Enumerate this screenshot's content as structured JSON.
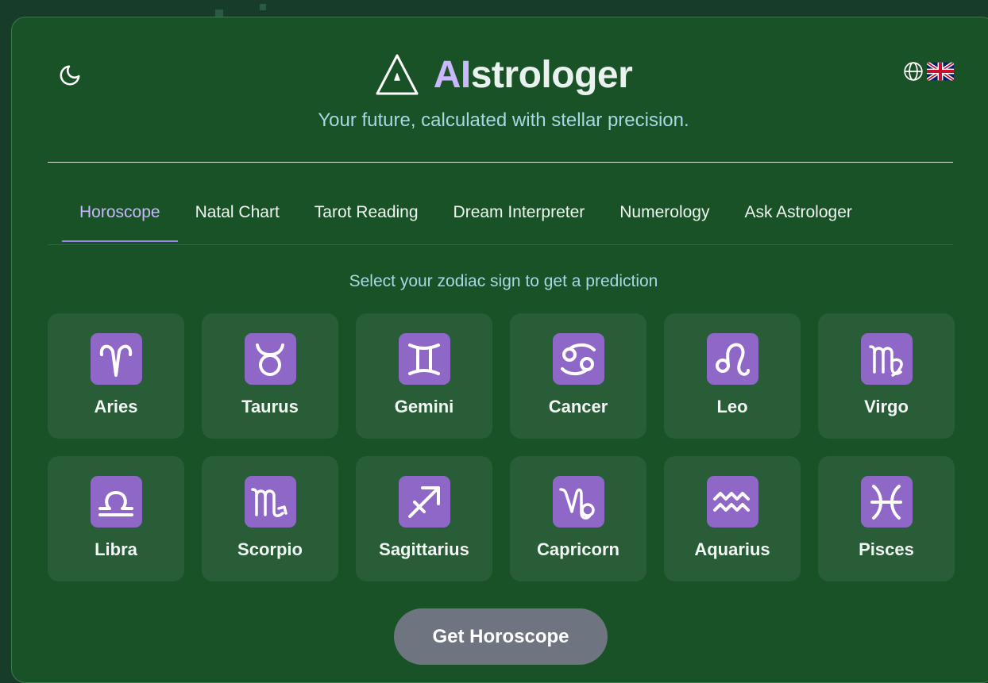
{
  "header": {
    "brand_ai": "AI",
    "brand_rest": "strologer",
    "tagline": "Your future, calculated with stellar precision.",
    "theme_icon": "moon-icon",
    "language_icon": "globe-icon",
    "language_flag": "uk-flag"
  },
  "tabs": [
    {
      "label": "Horoscope",
      "active": true
    },
    {
      "label": "Natal Chart",
      "active": false
    },
    {
      "label": "Tarot Reading",
      "active": false
    },
    {
      "label": "Dream Interpreter",
      "active": false
    },
    {
      "label": "Numerology",
      "active": false
    },
    {
      "label": "Ask Astrologer",
      "active": false
    }
  ],
  "prompt": "Select your zodiac sign to get a prediction",
  "signs": [
    {
      "name": "Aries",
      "icon": "aries-icon"
    },
    {
      "name": "Taurus",
      "icon": "taurus-icon"
    },
    {
      "name": "Gemini",
      "icon": "gemini-icon"
    },
    {
      "name": "Cancer",
      "icon": "cancer-icon"
    },
    {
      "name": "Leo",
      "icon": "leo-icon"
    },
    {
      "name": "Virgo",
      "icon": "virgo-icon"
    },
    {
      "name": "Libra",
      "icon": "libra-icon"
    },
    {
      "name": "Scorpio",
      "icon": "scorpio-icon"
    },
    {
      "name": "Sagittarius",
      "icon": "sagittarius-icon"
    },
    {
      "name": "Capricorn",
      "icon": "capricorn-icon"
    },
    {
      "name": "Aquarius",
      "icon": "aquarius-icon"
    },
    {
      "name": "Pisces",
      "icon": "pisces-icon"
    }
  ],
  "cta_label": "Get Horoscope",
  "colors": {
    "background": "#173d2a",
    "card": "#1a5227",
    "tile": "#285d37",
    "accent_purple": "#8f67c7",
    "active_tab": "#c7b7ff",
    "tagline": "#a7d8e2",
    "button": "#6e7480"
  }
}
